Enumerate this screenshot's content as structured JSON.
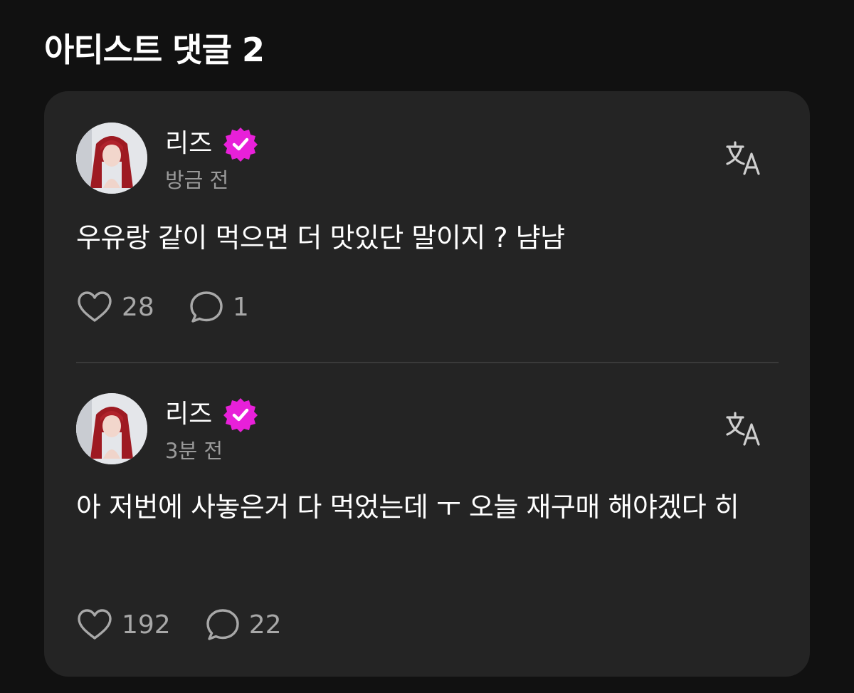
{
  "header": {
    "title": "아티스트 댓글 2"
  },
  "colors": {
    "background": "#111111",
    "card": "#242424",
    "verified_badge": "#e820d9",
    "muted_text": "#9a9a9a"
  },
  "comments": [
    {
      "author": "리즈",
      "verified": true,
      "timestamp": "방금 전",
      "text": "우유랑 같이 먹으면 더 맛있단 말이지 ? 냠냠",
      "likes": "28",
      "replies": "1",
      "icons": {
        "like": "heart-icon",
        "reply": "speech-bubble-icon",
        "translate": "translate-icon"
      }
    },
    {
      "author": "리즈",
      "verified": true,
      "timestamp": "3분 전",
      "text": "아 저번에 사놓은거 다 먹었는데 ㅜ 오늘 재구매 해야겠다 히",
      "likes": "192",
      "replies": "22",
      "icons": {
        "like": "heart-icon",
        "reply": "speech-bubble-icon",
        "translate": "translate-icon"
      }
    }
  ]
}
